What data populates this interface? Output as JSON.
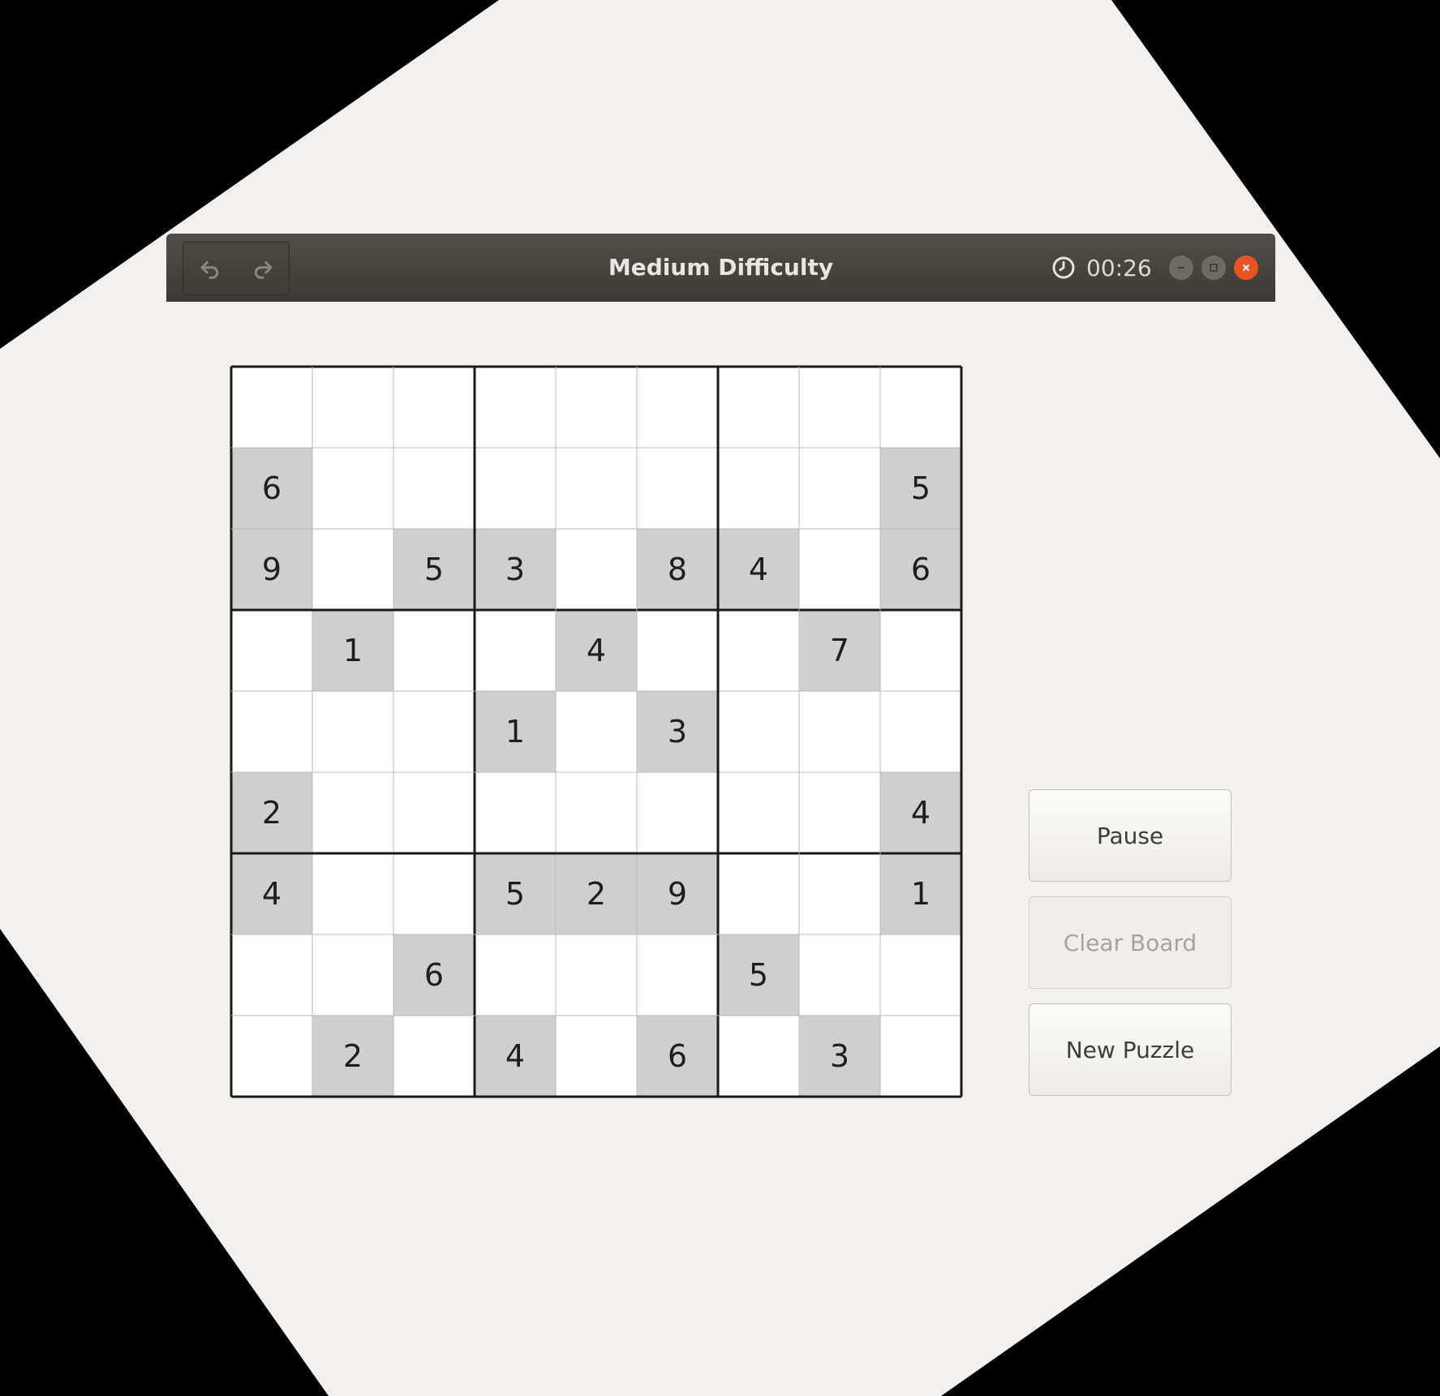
{
  "window": {
    "title": "Medium Difficulty",
    "timer": "00:26",
    "accent_color": "#e95420"
  },
  "toolbar": {
    "undo_icon": "undo-icon",
    "redo_icon": "redo-icon",
    "clock_icon": "clock-icon"
  },
  "board": {
    "given_color": "#cfcfcf",
    "rows": [
      [
        "",
        "",
        "",
        "",
        "",
        "",
        "",
        "",
        ""
      ],
      [
        "6",
        "",
        "",
        "",
        "",
        "",
        "",
        "",
        "5"
      ],
      [
        "9",
        "",
        "5",
        "3",
        "",
        "8",
        "4",
        "",
        "6"
      ],
      [
        "",
        "1",
        "",
        "",
        "4",
        "",
        "",
        "7",
        ""
      ],
      [
        "",
        "",
        "",
        "1",
        "",
        "3",
        "",
        "",
        ""
      ],
      [
        "2",
        "",
        "",
        "",
        "",
        "",
        "",
        "",
        "4"
      ],
      [
        "4",
        "",
        "",
        "5",
        "2",
        "9",
        "",
        "",
        "1"
      ],
      [
        "",
        "",
        "6",
        "",
        "",
        "",
        "5",
        "",
        ""
      ],
      [
        "",
        "2",
        "",
        "4",
        "",
        "6",
        "",
        "3",
        ""
      ]
    ]
  },
  "buttons": {
    "pause": "Pause",
    "clear_board": "Clear Board",
    "new_puzzle": "New Puzzle"
  }
}
